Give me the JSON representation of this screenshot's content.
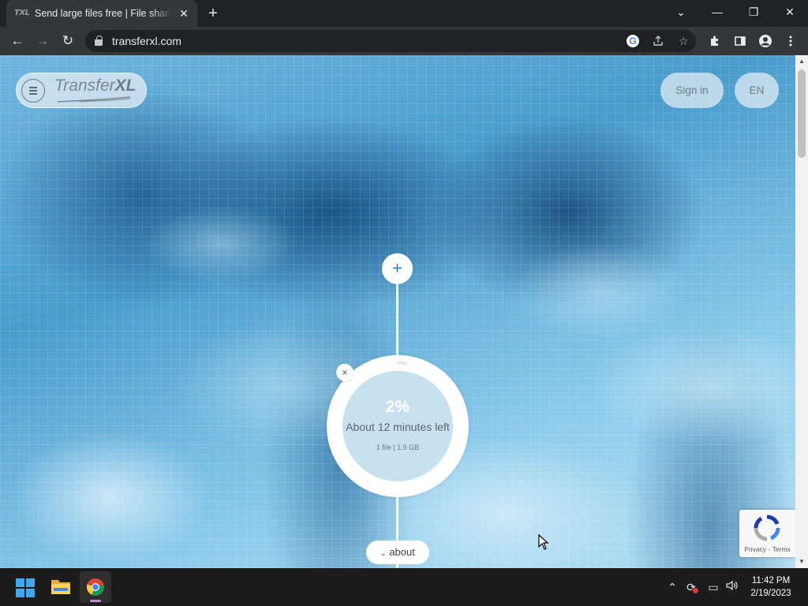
{
  "browser": {
    "tab": {
      "favicon": "TXL",
      "title": "Send large files free | File sharing",
      "close": "✕"
    },
    "new_tab": "+",
    "window_controls": {
      "tab_search": "⌄",
      "minimize": "—",
      "restore": "❐",
      "close": "✕"
    },
    "nav": {
      "back": "←",
      "forward": "→",
      "reload": "↻"
    },
    "url": "transferxl.com",
    "omnibox_icons": [
      "google-icon",
      "share-icon",
      "bookmark-star-icon"
    ],
    "toolbar_icons": [
      "extensions-icon",
      "side-panel-icon",
      "profile-icon",
      "menu-icon"
    ]
  },
  "page": {
    "logo": {
      "text_light": "Transfer",
      "text_bold": "XL"
    },
    "sign_in": "Sign in",
    "language": "EN",
    "add_files": "+",
    "transfer": {
      "percent_label": "2%",
      "progress": 0.02,
      "time_left": "About 12 minutes left",
      "details": "1 file | 1.9 GB",
      "cancel": "×"
    },
    "about": "about",
    "recaptcha": {
      "links": "Privacy - Terms"
    }
  },
  "taskbar": {
    "apps": [
      "windows-start",
      "file-explorer",
      "google-chrome"
    ],
    "tray": {
      "chevron": "⌃",
      "sync": "⟳",
      "display": "▭",
      "volume": "🔊"
    },
    "clock": {
      "time": "11:42 PM",
      "date": "2/19/2023"
    }
  },
  "colors": {
    "accent": "#2a7fbf",
    "chrome_dark": "#202124",
    "chrome_toolbar": "#35363a"
  }
}
